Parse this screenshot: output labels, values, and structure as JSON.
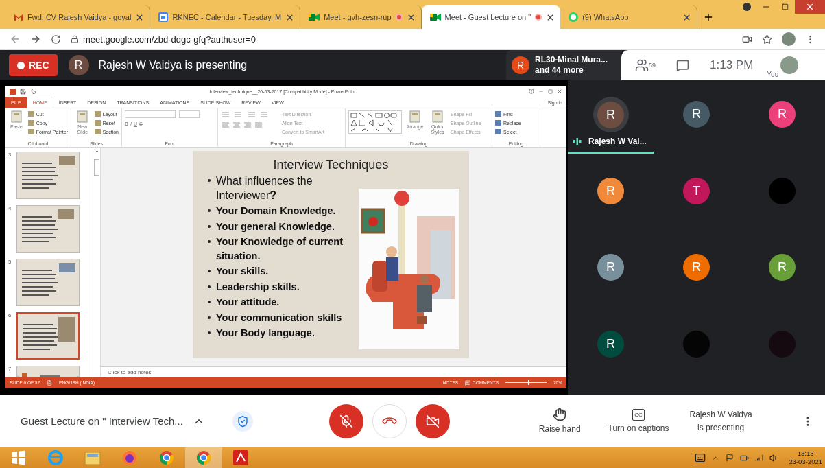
{
  "browser": {
    "tabs": [
      {
        "title": "Fwd: CV Rajesh Vaidya - goyal",
        "kind": "mail",
        "selected": false,
        "recording": false
      },
      {
        "title": "RKNEC - Calendar - Tuesday, M",
        "kind": "calendar",
        "selected": false,
        "recording": false
      },
      {
        "title": "Meet - gvh-zesn-rup",
        "kind": "meet",
        "selected": false,
        "recording": true
      },
      {
        "title": "Meet - Guest Lecture on \"",
        "kind": "meet",
        "selected": true,
        "recording": true
      },
      {
        "title": "(9) WhatsApp",
        "kind": "chat",
        "selected": false,
        "recording": false
      }
    ],
    "url": "meet.google.com/zbd-dqgc-gfq?authuser=0"
  },
  "meet_header": {
    "rec": "REC",
    "presenter_initial": "R",
    "presenting": "Rajesh W Vaidya is presenting",
    "joined_initial": "R",
    "joined_name": "RL30-Minal Mura...",
    "joined_more": "and 44 more",
    "people_count": "59",
    "time": "1:13 PM",
    "you": "You"
  },
  "powerpoint": {
    "title": "Interview_technique__20-03-2017 [Compatibility Mode] - PowerPoint",
    "sign_in": "Sign in",
    "ribbon_tabs": [
      {
        "label": "FILE",
        "kind": "file",
        "selected": false
      },
      {
        "label": "HOME",
        "kind": "tab",
        "selected": true
      },
      {
        "label": "INSERT",
        "kind": "tab",
        "selected": false
      },
      {
        "label": "DESIGN",
        "kind": "tab",
        "selected": false
      },
      {
        "label": "TRANSITIONS",
        "kind": "tab",
        "selected": false
      },
      {
        "label": "ANIMATIONS",
        "kind": "tab",
        "selected": false
      },
      {
        "label": "SLIDE SHOW",
        "kind": "tab",
        "selected": false
      },
      {
        "label": "REVIEW",
        "kind": "tab",
        "selected": false
      },
      {
        "label": "VIEW",
        "kind": "tab",
        "selected": false
      }
    ],
    "groups": [
      {
        "label": "Clipboard",
        "kind": "plain",
        "bigs": [
          "Paste"
        ],
        "items": [
          "Cut",
          "Copy",
          "Format Painter"
        ]
      },
      {
        "label": "Slides",
        "kind": "plain",
        "bigs": [
          "New Slide"
        ],
        "items": [
          "Layout",
          "Reset",
          "Section"
        ]
      },
      {
        "label": "Font",
        "kind": "font",
        "items": [
          "B",
          "I",
          "U",
          "S"
        ]
      },
      {
        "label": "Paragraph",
        "kind": "paragraph",
        "items": [
          "Text Direction",
          "Align Text",
          "Convert to SmartArt"
        ]
      },
      {
        "label": "Drawing",
        "kind": "drawing",
        "bigs": [
          "Arrange",
          "Quick Styles"
        ],
        "items": [
          "Shape Fill",
          "Shape Outline",
          "Shape Effects"
        ]
      },
      {
        "label": "Editing",
        "kind": "plain",
        "items": [
          "Find",
          "Replace",
          "Select"
        ]
      }
    ],
    "thumbnails": [
      {
        "number": "3",
        "selected": false
      },
      {
        "number": "4",
        "selected": false
      },
      {
        "number": "5",
        "selected": false
      },
      {
        "number": "6",
        "selected": true
      },
      {
        "number": "7",
        "selected": false
      }
    ],
    "slide": {
      "title": "Interview Techniques",
      "bullets": [
        {
          "text": "What influences the Interviewer**?**",
          "bold": false
        },
        {
          "text": "Your Domain Knowledge.",
          "bold": true
        },
        {
          "text": "Your general Knowledge.",
          "bold": true
        },
        {
          "text": "Your Knowledge of current situation.",
          "bold": true
        },
        {
          "text": "Your skills.",
          "bold": true
        },
        {
          "text": "Leadership skills.",
          "bold": true
        },
        {
          "text": "Your attitude.",
          "bold": true
        },
        {
          "text": "Your communication skills",
          "bold": true
        },
        {
          "text": "Your Body language.",
          "bold": true
        }
      ]
    },
    "notes_placeholder": "Click to add notes",
    "status": {
      "slide": "SLIDE 6 OF 52",
      "language": "ENGLISH (INDIA)",
      "notes": "NOTES",
      "comments": "COMMENTS",
      "zoom": "70%",
      "level": 0.55
    }
  },
  "participants": [
    {
      "initial": "R",
      "color": "#6d4c41",
      "speaking": true,
      "name": "Rajesh W Vai..."
    },
    {
      "initial": "R",
      "color": "#455a64",
      "speaking": false
    },
    {
      "initial": "R",
      "color": "#ec407a",
      "speaking": false
    },
    {
      "initial": "R",
      "color": "#f08a3a",
      "speaking": false
    },
    {
      "initial": "T",
      "color": "#c2185b",
      "speaking": false
    },
    {
      "color": "#000000",
      "speaking": false
    },
    {
      "initial": "R",
      "color": "#78909c",
      "speaking": false
    },
    {
      "initial": "R",
      "color": "#ef6c00",
      "speaking": false
    },
    {
      "initial": "R",
      "color": "#689f38",
      "speaking": false
    },
    {
      "initial": "R",
      "color": "#004d40",
      "speaking": false
    },
    {
      "color": "#050505",
      "speaking": false
    },
    {
      "color": "#150a10",
      "speaking": false
    }
  ],
  "bottom_bar": {
    "meeting_title": "Guest Lecture on \" Interview Tech...",
    "mic_on": false,
    "camera_on": false,
    "raise_hand": "Raise hand",
    "captions_icon": "CC",
    "captions": "Turn on captions",
    "presenter_name": "Rajesh W Vaidya",
    "presenter_status": "is presenting"
  },
  "taskbar": {
    "apps": [
      {
        "kind": "browser-e",
        "selected": false
      },
      {
        "kind": "folder",
        "selected": false
      },
      {
        "kind": "fox",
        "selected": false
      },
      {
        "kind": "chrome",
        "selected": false
      },
      {
        "kind": "chrome",
        "selected": true
      },
      {
        "kind": "pdf",
        "selected": false
      }
    ],
    "time": "13:13",
    "date": "23-03-2021"
  }
}
